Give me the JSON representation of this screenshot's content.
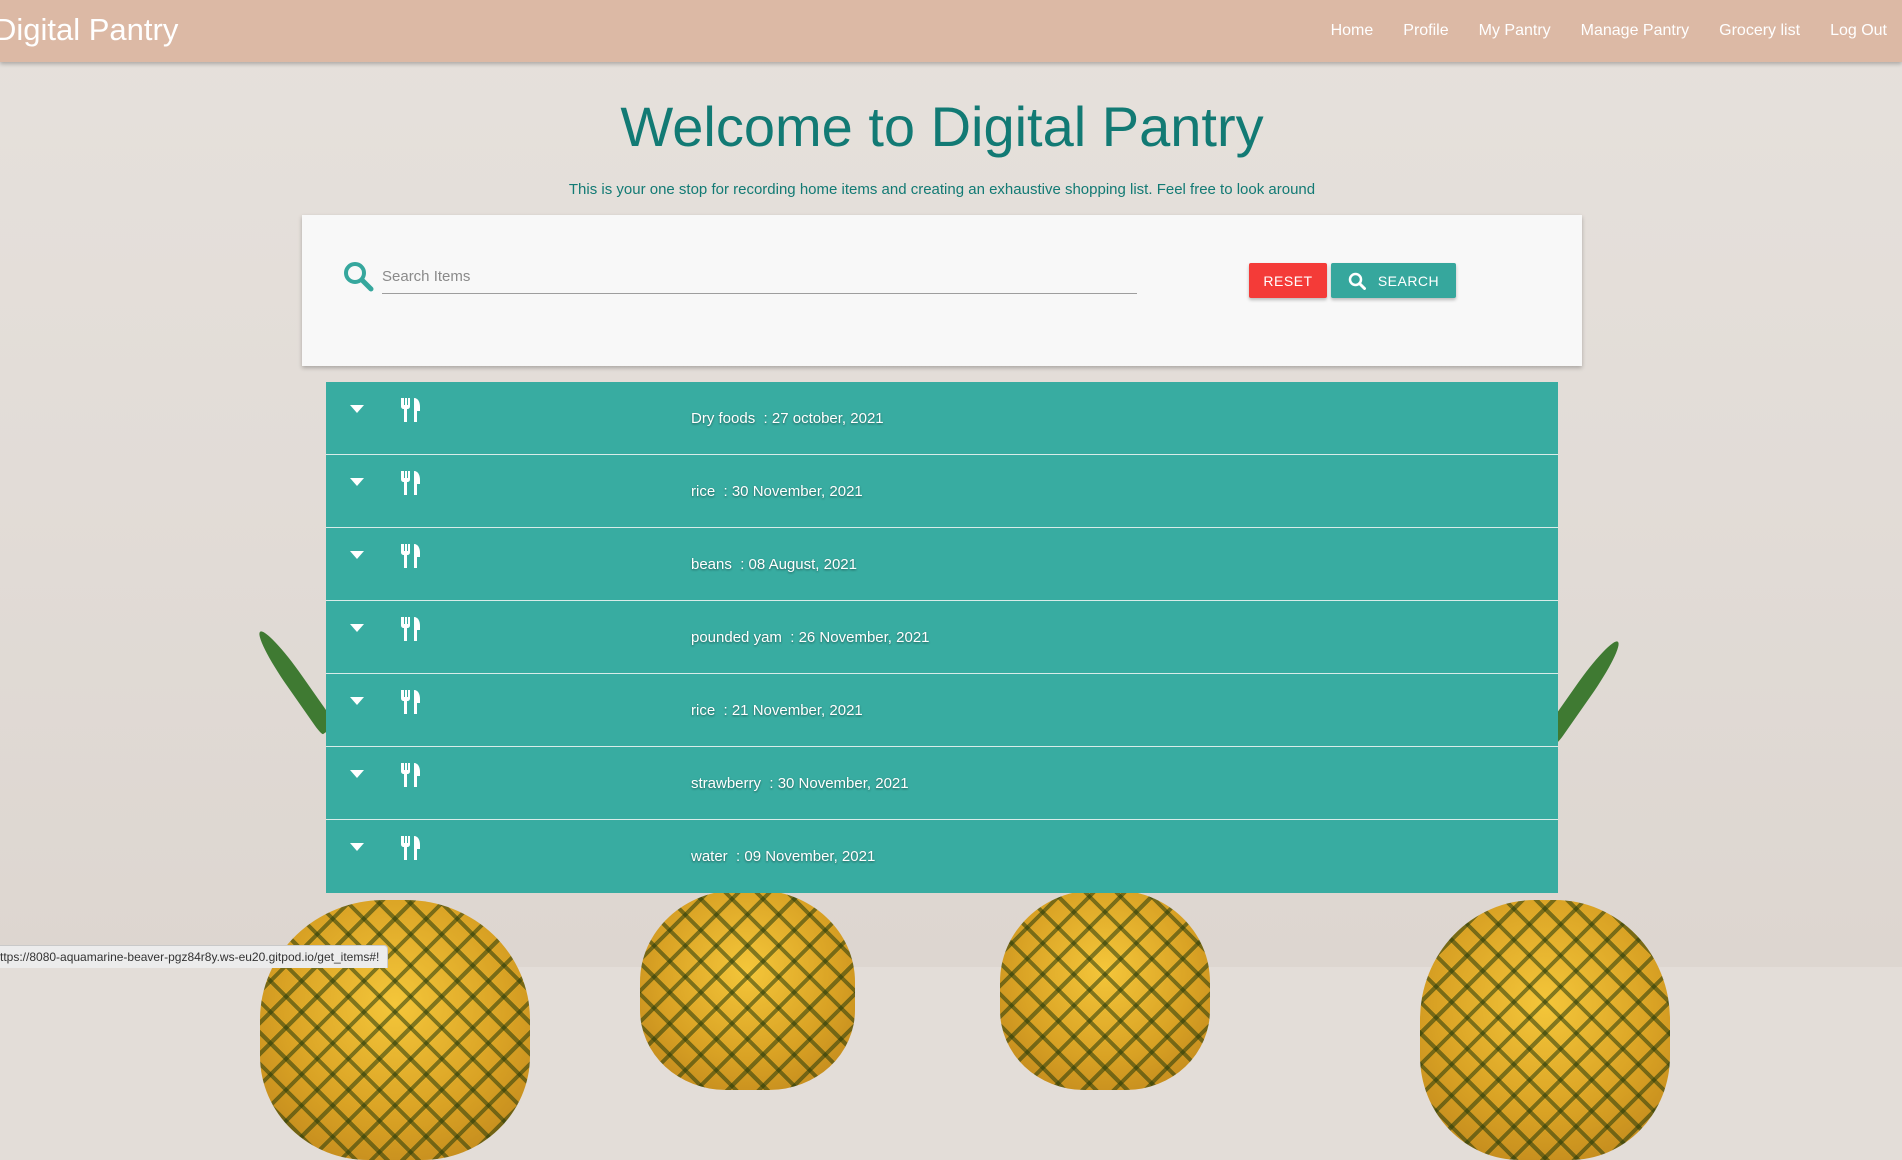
{
  "navbar": {
    "brand": "Digital Pantry",
    "links": [
      "Home",
      "Profile",
      "My Pantry",
      "Manage Pantry",
      "Grocery list",
      "Log Out"
    ]
  },
  "hero": {
    "title": "Welcome to Digital Pantry",
    "subtitle": "This is your one stop for recording home items and creating an exhaustive shopping list. Feel free to look around"
  },
  "search": {
    "placeholder": "Search Items",
    "value": "",
    "reset_label": "RESET",
    "search_label": "SEARCH"
  },
  "items": [
    {
      "name": "Dry foods",
      "date": "27 october, 2021"
    },
    {
      "name": "rice",
      "date": "30 November, 2021"
    },
    {
      "name": "beans",
      "date": "08 August, 2021"
    },
    {
      "name": "pounded yam",
      "date": "26 November, 2021"
    },
    {
      "name": "rice",
      "date": "21 November, 2021"
    },
    {
      "name": "strawberry",
      "date": "30 November, 2021"
    },
    {
      "name": "water",
      "date": "09 November, 2021"
    }
  ],
  "status_url": "ttps://8080-aquamarine-beaver-pgz84r8y.ws-eu20.gitpod.io/get_items#!",
  "icons": {
    "row_toggle": "caret-down-icon",
    "row_icon": "utensils-icon",
    "search": "search-icon"
  },
  "colors": {
    "navbar": "#dcb9a5",
    "teal": "#38aca1",
    "title": "#127a74",
    "reset": "#f43b38"
  }
}
